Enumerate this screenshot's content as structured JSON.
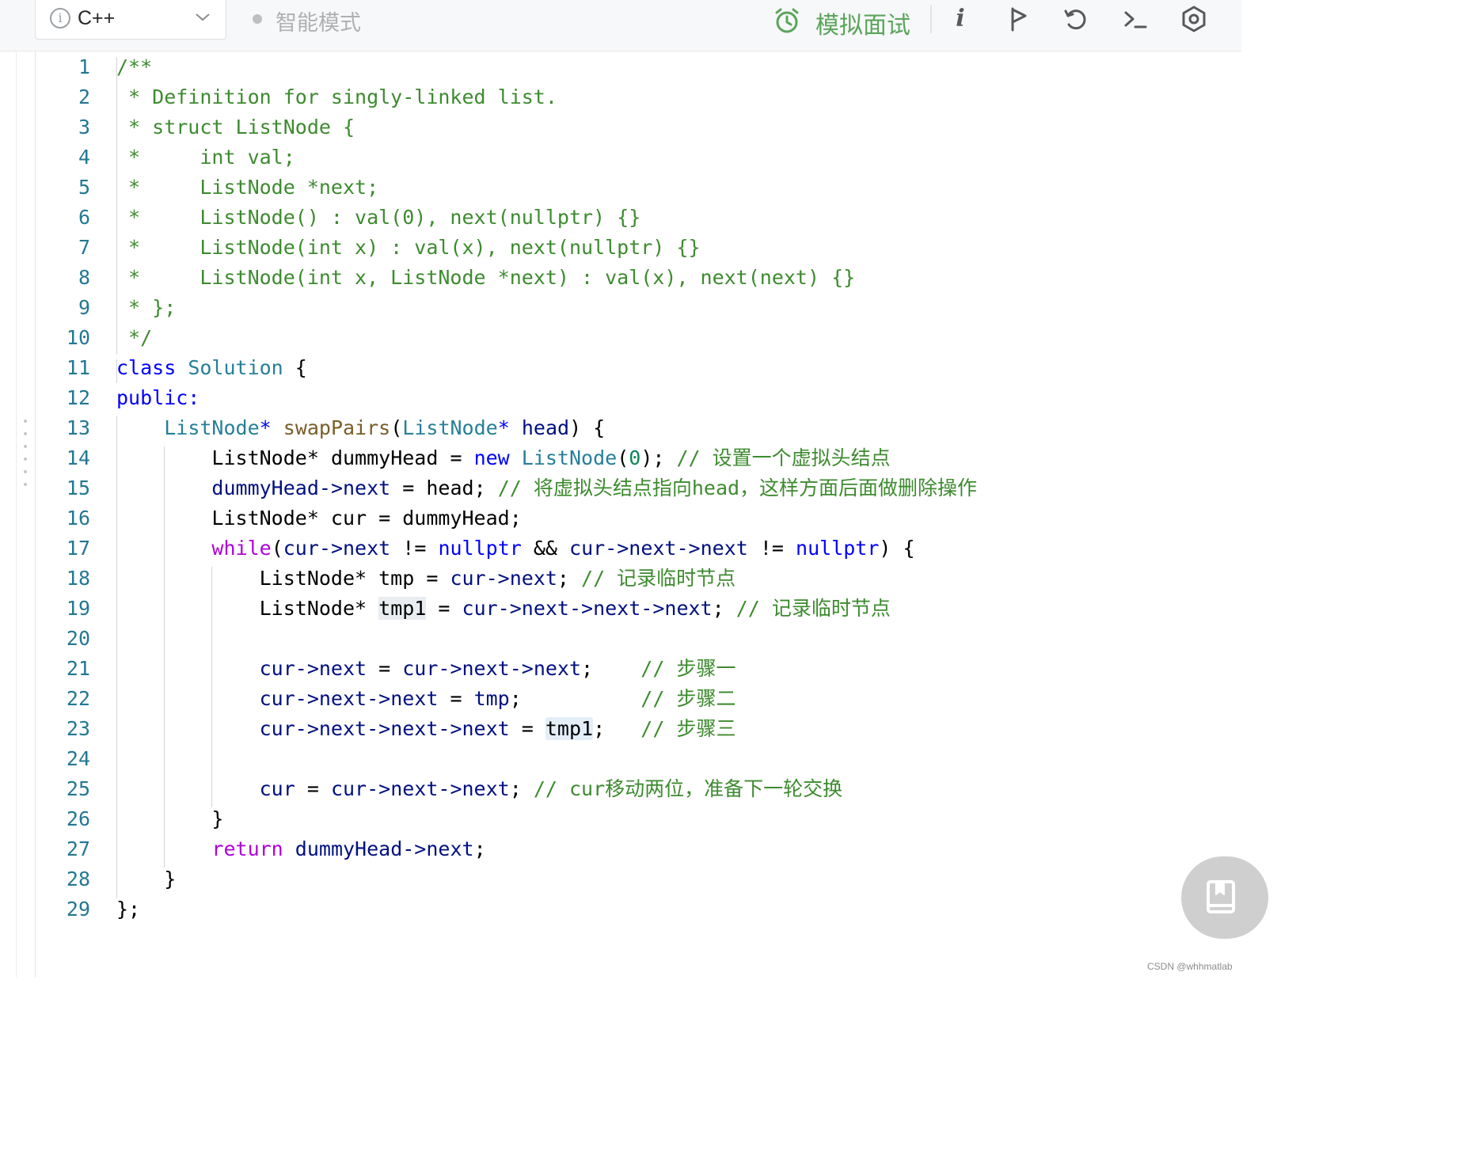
{
  "toolbar": {
    "language": "C++",
    "mode_label": "智能模式",
    "mock_interview_label": "模拟面试"
  },
  "editor": {
    "lines": [
      {
        "n": "1",
        "tokens": [
          {
            "t": "/**",
            "c": "cm"
          }
        ]
      },
      {
        "n": "2",
        "tokens": [
          {
            "t": " * Definition for singly-linked list.",
            "c": "cm"
          }
        ]
      },
      {
        "n": "3",
        "tokens": [
          {
            "t": " * struct ListNode {",
            "c": "cm"
          }
        ]
      },
      {
        "n": "4",
        "tokens": [
          {
            "t": " *     int val;",
            "c": "cm"
          }
        ]
      },
      {
        "n": "5",
        "tokens": [
          {
            "t": " *     ListNode *next;",
            "c": "cm"
          }
        ]
      },
      {
        "n": "6",
        "tokens": [
          {
            "t": " *     ListNode() : val(0), next(nullptr) {}",
            "c": "cm"
          }
        ]
      },
      {
        "n": "7",
        "tokens": [
          {
            "t": " *     ListNode(int x) : val(x), next(nullptr) {}",
            "c": "cm"
          }
        ]
      },
      {
        "n": "8",
        "tokens": [
          {
            "t": " *     ListNode(int x, ListNode *next) : val(x), next(next) {}",
            "c": "cm"
          }
        ]
      },
      {
        "n": "9",
        "tokens": [
          {
            "t": " * };",
            "c": "cm"
          }
        ]
      },
      {
        "n": "10",
        "tokens": [
          {
            "t": " */",
            "c": "cm"
          }
        ]
      },
      {
        "n": "11",
        "tokens": [
          {
            "t": "class",
            "c": "kw"
          },
          {
            "t": " "
          },
          {
            "t": "Solution",
            "c": "ty"
          },
          {
            "t": " {"
          }
        ]
      },
      {
        "n": "12",
        "tokens": [
          {
            "t": "public:",
            "c": "kw"
          }
        ]
      },
      {
        "n": "13",
        "tokens": [
          {
            "t": "    "
          },
          {
            "t": "ListNode",
            "c": "ty"
          },
          {
            "t": "*",
            "c": "kw"
          },
          {
            "t": " "
          },
          {
            "t": "swapPairs",
            "c": "fn"
          },
          {
            "t": "("
          },
          {
            "t": "ListNode",
            "c": "ty"
          },
          {
            "t": "*",
            "c": "kw"
          },
          {
            "t": " "
          },
          {
            "t": "head",
            "c": "vr"
          },
          {
            "t": ") {"
          }
        ]
      },
      {
        "n": "14",
        "tokens": [
          {
            "t": "        ListNode* "
          },
          {
            "t": "dummyHead"
          },
          {
            "t": " = "
          },
          {
            "t": "new",
            "c": "kw"
          },
          {
            "t": " "
          },
          {
            "t": "ListNode",
            "c": "ty"
          },
          {
            "t": "("
          },
          {
            "t": "0",
            "c": "nm"
          },
          {
            "t": "); "
          },
          {
            "t": "// 设置一个虚拟头结点",
            "c": "cm"
          }
        ]
      },
      {
        "n": "15",
        "tokens": [
          {
            "t": "        "
          },
          {
            "t": "dummyHead",
            "c": "vr"
          },
          {
            "t": "->",
            "c": "vr"
          },
          {
            "t": "next",
            "c": "vr"
          },
          {
            "t": " = head; "
          },
          {
            "t": "// 将虚拟头结点指向head，这样方面后面做删除操作",
            "c": "cm"
          }
        ]
      },
      {
        "n": "16",
        "tokens": [
          {
            "t": "        ListNode* cur = dummyHead;"
          }
        ]
      },
      {
        "n": "17",
        "tokens": [
          {
            "t": "        "
          },
          {
            "t": "while",
            "c": "ctl"
          },
          {
            "t": "("
          },
          {
            "t": "cur->next",
            "c": "vr"
          },
          {
            "t": " != "
          },
          {
            "t": "nullptr",
            "c": "kw"
          },
          {
            "t": " && "
          },
          {
            "t": "cur->next->next",
            "c": "vr"
          },
          {
            "t": " != "
          },
          {
            "t": "nullptr",
            "c": "kw"
          },
          {
            "t": ") {"
          }
        ]
      },
      {
        "n": "18",
        "tokens": [
          {
            "t": "            ListNode* tmp = "
          },
          {
            "t": "cur->next",
            "c": "vr"
          },
          {
            "t": "; "
          },
          {
            "t": "// 记录临时节点",
            "c": "cm"
          }
        ]
      },
      {
        "n": "19",
        "tokens": [
          {
            "t": "            ListNode* "
          },
          {
            "t": "tmp1",
            "c": "hl2"
          },
          {
            "t": " = "
          },
          {
            "t": "cur->next->next->next",
            "c": "vr"
          },
          {
            "t": "; "
          },
          {
            "t": "// 记录临时节点",
            "c": "cm"
          }
        ]
      },
      {
        "n": "20",
        "tokens": [
          {
            "t": ""
          }
        ]
      },
      {
        "n": "21",
        "tokens": [
          {
            "t": "            "
          },
          {
            "t": "cur->next",
            "c": "vr"
          },
          {
            "t": " = "
          },
          {
            "t": "cur->next->next",
            "c": "vr"
          },
          {
            "t": ";    "
          },
          {
            "t": "// 步骤一",
            "c": "cm"
          }
        ]
      },
      {
        "n": "22",
        "tokens": [
          {
            "t": "            "
          },
          {
            "t": "cur->next->next",
            "c": "vr"
          },
          {
            "t": " = "
          },
          {
            "t": "tmp",
            "c": "vr"
          },
          {
            "t": ";          "
          },
          {
            "t": "// 步骤二",
            "c": "cm"
          }
        ]
      },
      {
        "n": "23",
        "tokens": [
          {
            "t": "            "
          },
          {
            "t": "cur->next->next->next",
            "c": "vr"
          },
          {
            "t": " = "
          },
          {
            "t": "tmp1",
            "c": "hl"
          },
          {
            "t": ";   "
          },
          {
            "t": "// 步骤三",
            "c": "cm"
          }
        ]
      },
      {
        "n": "24",
        "tokens": [
          {
            "t": ""
          }
        ]
      },
      {
        "n": "25",
        "tokens": [
          {
            "t": "            "
          },
          {
            "t": "cur",
            "c": "vr"
          },
          {
            "t": " = "
          },
          {
            "t": "cur->next->next",
            "c": "vr"
          },
          {
            "t": "; "
          },
          {
            "t": "// cur移动两位，准备下一轮交换",
            "c": "cm"
          }
        ]
      },
      {
        "n": "26",
        "tokens": [
          {
            "t": "        }"
          }
        ]
      },
      {
        "n": "27",
        "tokens": [
          {
            "t": "        "
          },
          {
            "t": "return",
            "c": "ctl"
          },
          {
            "t": " "
          },
          {
            "t": "dummyHead->next",
            "c": "vr"
          },
          {
            "t": ";"
          }
        ]
      },
      {
        "n": "28",
        "tokens": [
          {
            "t": "    }"
          }
        ]
      },
      {
        "n": "29",
        "tokens": [
          {
            "t": "};"
          }
        ]
      }
    ]
  },
  "watermark": "CSDN @whhmatlab",
  "colors": {
    "comment": "#3d8b2f",
    "keyword": "#0000ff",
    "type": "#267f99",
    "function": "#795e26",
    "variable": "#001080",
    "accent_green": "#5aa55a"
  }
}
